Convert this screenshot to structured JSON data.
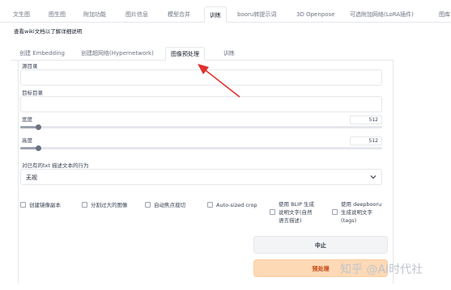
{
  "top_tabs": [
    "文生图",
    "图生图",
    "附加功能",
    "图片信息",
    "模型合并",
    "训练",
    "booru转提示词",
    "3D Openpose",
    "可选附加网络(LoRA插件)",
    "图库"
  ],
  "active_top_tab": "训练",
  "notice": "查看wiki文档以了解详细说明",
  "sub_tabs": [
    "创建 Embedding",
    "创建超网络(Hypernetwork)",
    "图像预处理",
    "训练"
  ],
  "active_sub_tab": "图像预处理",
  "fields": {
    "source_dir_label": "源目录",
    "source_dir_value": "",
    "target_dir_label": "目标目录",
    "target_dir_value": ""
  },
  "sliders": {
    "width_label": "宽度",
    "width_value": "512",
    "width_fraction": 0.05,
    "height_label": "高度",
    "height_value": "512",
    "height_fraction": 0.05
  },
  "caption_action": {
    "label": "对已有的txt 描述文本的行为",
    "value": "无视"
  },
  "checkboxes": {
    "mirror": "创建镜像副本",
    "split": "分割过大的图像",
    "autofocus": "自动焦点裁切",
    "autosize": "Auto-sized crop",
    "blip_1": "使用 BLIP 生成",
    "blip_2": "说明文字(自然",
    "blip_3": "语言描述)",
    "deepbooru_1": "使用 deepbooru",
    "deepbooru_2": "生成说明文字",
    "deepbooru_3": "(tags)"
  },
  "buttons": {
    "interrupt": "中止",
    "preprocess": "预处理"
  },
  "watermark": "知乎 @AI时代社",
  "colors": {
    "arrow": "#e03131",
    "preprocess_bg": "#fdd9b5",
    "preprocess_text": "#c2410c"
  }
}
